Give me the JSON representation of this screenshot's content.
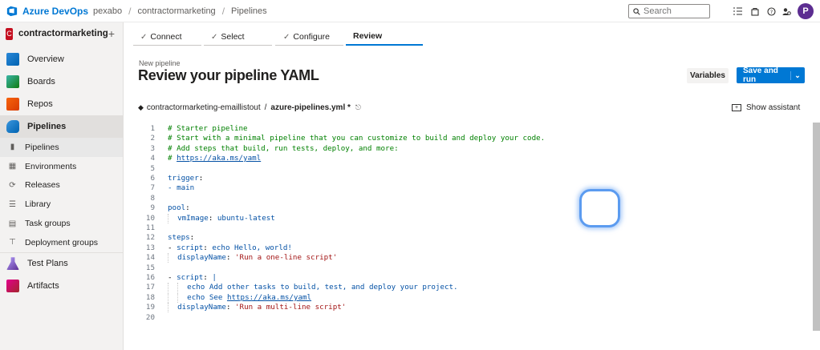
{
  "topbar": {
    "brand": "Azure DevOps",
    "org": "pexabo",
    "project": "contractormarketing",
    "page": "Pipelines",
    "search_placeholder": "Search",
    "avatar_initial": "P"
  },
  "sidebar": {
    "project_badge": "C",
    "project_name": "contractormarketing",
    "add_symbol": "+",
    "items": [
      {
        "label": "Overview",
        "icon": "overview-icon"
      },
      {
        "label": "Boards",
        "icon": "boards-icon"
      },
      {
        "label": "Repos",
        "icon": "repos-icon"
      },
      {
        "label": "Pipelines",
        "icon": "pipelines-icon"
      },
      {
        "label": "Test Plans",
        "icon": "test-plans-icon"
      },
      {
        "label": "Artifacts",
        "icon": "artifacts-icon"
      }
    ],
    "pipeline_sub": [
      {
        "label": "Pipelines",
        "icon": "bar-chart-icon"
      },
      {
        "label": "Environments",
        "icon": "environments-icon"
      },
      {
        "label": "Releases",
        "icon": "releases-icon"
      },
      {
        "label": "Library",
        "icon": "library-icon"
      },
      {
        "label": "Task groups",
        "icon": "task-groups-icon"
      },
      {
        "label": "Deployment groups",
        "icon": "deployment-groups-icon"
      }
    ]
  },
  "wizard": {
    "steps": [
      {
        "label": "Connect",
        "done": true
      },
      {
        "label": "Select",
        "done": true
      },
      {
        "label": "Configure",
        "done": true
      },
      {
        "label": "Review",
        "done": false
      }
    ]
  },
  "header": {
    "subtitle": "New pipeline",
    "title": "Review your pipeline YAML",
    "variables_label": "Variables",
    "run_label": "Save and run"
  },
  "file": {
    "repo": "contractormarketing-emaillistout",
    "separator": "/",
    "filename": "azure-pipelines.yml *",
    "show_assistant": "Show assistant"
  },
  "editor": {
    "lines": [
      "# Starter pipeline",
      "# Start with a minimal pipeline that you can customize to build and deploy your code.",
      "# Add steps that build, run tests, deploy, and more:",
      "# https://aka.ms/yaml",
      "",
      "trigger:",
      "- main",
      "",
      "pool:",
      "  vmImage: ubuntu-latest",
      "",
      "steps:",
      "- script: echo Hello, world!",
      "  displayName: 'Run a one-line script'",
      "",
      "- script: |",
      "    echo Add other tasks to build, test, and deploy your project.",
      "    echo See https://aka.ms/yaml",
      "  displayName: 'Run a multi-line script'",
      ""
    ]
  },
  "colors": {
    "accent": "#0078d4",
    "sidebar_bg": "#f3f2f1",
    "comment": "#008000",
    "key": "#0451a5",
    "string": "#a31515"
  }
}
